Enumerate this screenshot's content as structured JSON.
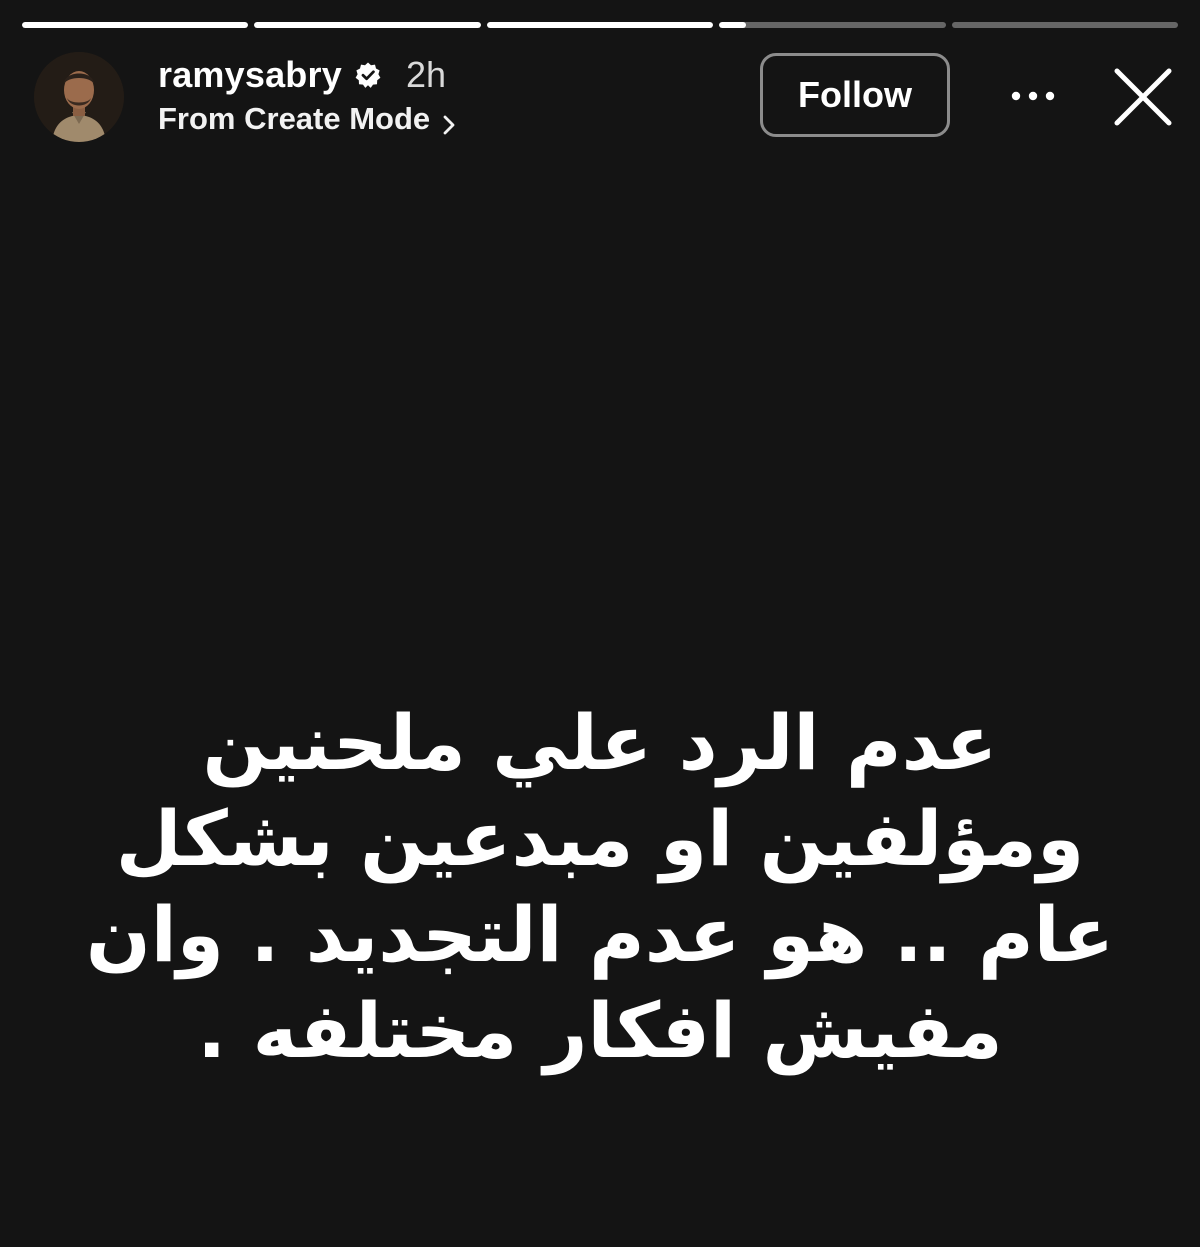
{
  "story": {
    "progress": {
      "segments": [
        1,
        1,
        1,
        0.12,
        0
      ]
    },
    "header": {
      "avatar_alt": "ramysabry",
      "username": "ramysabry",
      "verified_icon": "verified-badge-icon",
      "time": "2h",
      "subtitle": "From Create Mode",
      "subtitle_icon": "chevron-right-icon",
      "follow_label": "Follow",
      "more_icon": "more-horizontal-icon",
      "close_icon": "close-icon"
    },
    "content": {
      "text": "عدم الرد علي ملحنين ومؤلفين او مبدعين بشكل عام .. هو عدم التجديد . وان مفيش افكار مختلفه ."
    },
    "colors": {
      "background": "#141414",
      "text": "#ffffff",
      "follow_border": "#8c8c8c"
    }
  }
}
